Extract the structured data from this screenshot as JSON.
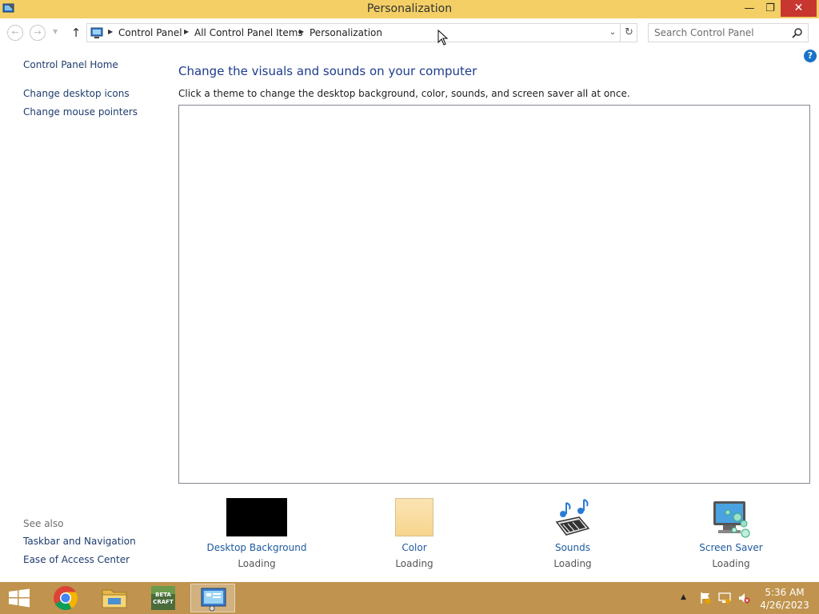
{
  "window": {
    "title": "Personalization",
    "minimize_glyph": "—",
    "restore_glyph": "❐",
    "close_glyph": "✕"
  },
  "address_bar": {
    "breadcrumbs": [
      "Control Panel",
      "All Control Panel Items",
      "Personalization"
    ],
    "search_placeholder": "Search Control Panel"
  },
  "left_pane": {
    "home": "Control Panel Home",
    "links": [
      "Change desktop icons",
      "Change mouse pointers"
    ],
    "see_also_heading": "See also",
    "see_also_links": [
      "Taskbar and Navigation",
      "Ease of Access Center"
    ]
  },
  "main": {
    "title": "Change the visuals and sounds on your computer",
    "subtitle": "Click a theme to change the desktop background, color, sounds, and screen saver all at once.",
    "help_glyph": "?",
    "tiles": [
      {
        "label": "Desktop Background",
        "status": "Loading",
        "icon": "desktop-background-thumbnail"
      },
      {
        "label": "Color",
        "status": "Loading",
        "icon": "color-swatch"
      },
      {
        "label": "Sounds",
        "status": "Loading",
        "icon": "sounds-icon"
      },
      {
        "label": "Screen Saver",
        "status": "Loading",
        "icon": "screen-saver-icon"
      }
    ]
  },
  "taskbar": {
    "apps": [
      "start",
      "chrome",
      "file-explorer",
      "betacraft",
      "control-panel"
    ],
    "clock_time": "5:36 AM",
    "clock_date": "4/26/2023"
  },
  "colors": {
    "title_bar": "#f3cf66",
    "taskbar": "#c0944e",
    "link": "#1e3c6e",
    "close_button": "#c7372f"
  }
}
